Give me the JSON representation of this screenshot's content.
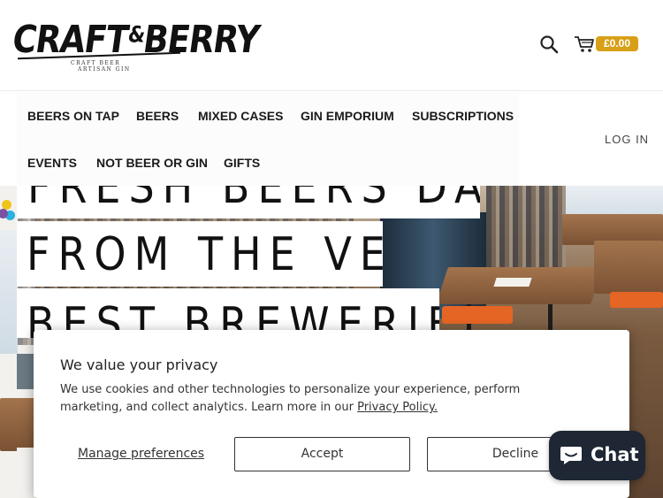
{
  "brand": {
    "logo_text_left": "CRAFT",
    "logo_amp": "&",
    "logo_text_right": "BERRY",
    "tagline_line1": "CRAFT BEER",
    "tagline_line2": "ARTISAN GIN"
  },
  "header": {
    "search_icon": "search-icon",
    "cart_icon": "cart-icon",
    "cart_total": "£0.00",
    "cart_badge_color": "#d8a017"
  },
  "nav": {
    "items": [
      {
        "label": "BEERS ON TAP"
      },
      {
        "label": "BEERS"
      },
      {
        "label": "MIXED CASES"
      },
      {
        "label": "GIN EMPORIUM"
      },
      {
        "label": "SUBSCRIPTIONS"
      },
      {
        "label": "EVENTS"
      },
      {
        "label": "NOT BEER OR GIN"
      },
      {
        "label": "GIFTS"
      }
    ],
    "login_label": "LOG IN"
  },
  "hero": {
    "lines": [
      "FRESH BEERS DAILY",
      "FROM THE VERY",
      "BEST BREWERIES!"
    ]
  },
  "cookie_banner": {
    "title": "We value your privacy",
    "body": "We use cookies and other technologies to personalize your experience, perform marketing, and collect analytics. Learn more in our ",
    "link_label": "Privacy Policy.",
    "manage_label": "Manage preferences",
    "accept_label": "Accept",
    "decline_label": "Decline"
  },
  "chat": {
    "label": "Chat",
    "icon": "chat-bubble-icon",
    "background": "#1e2733"
  }
}
